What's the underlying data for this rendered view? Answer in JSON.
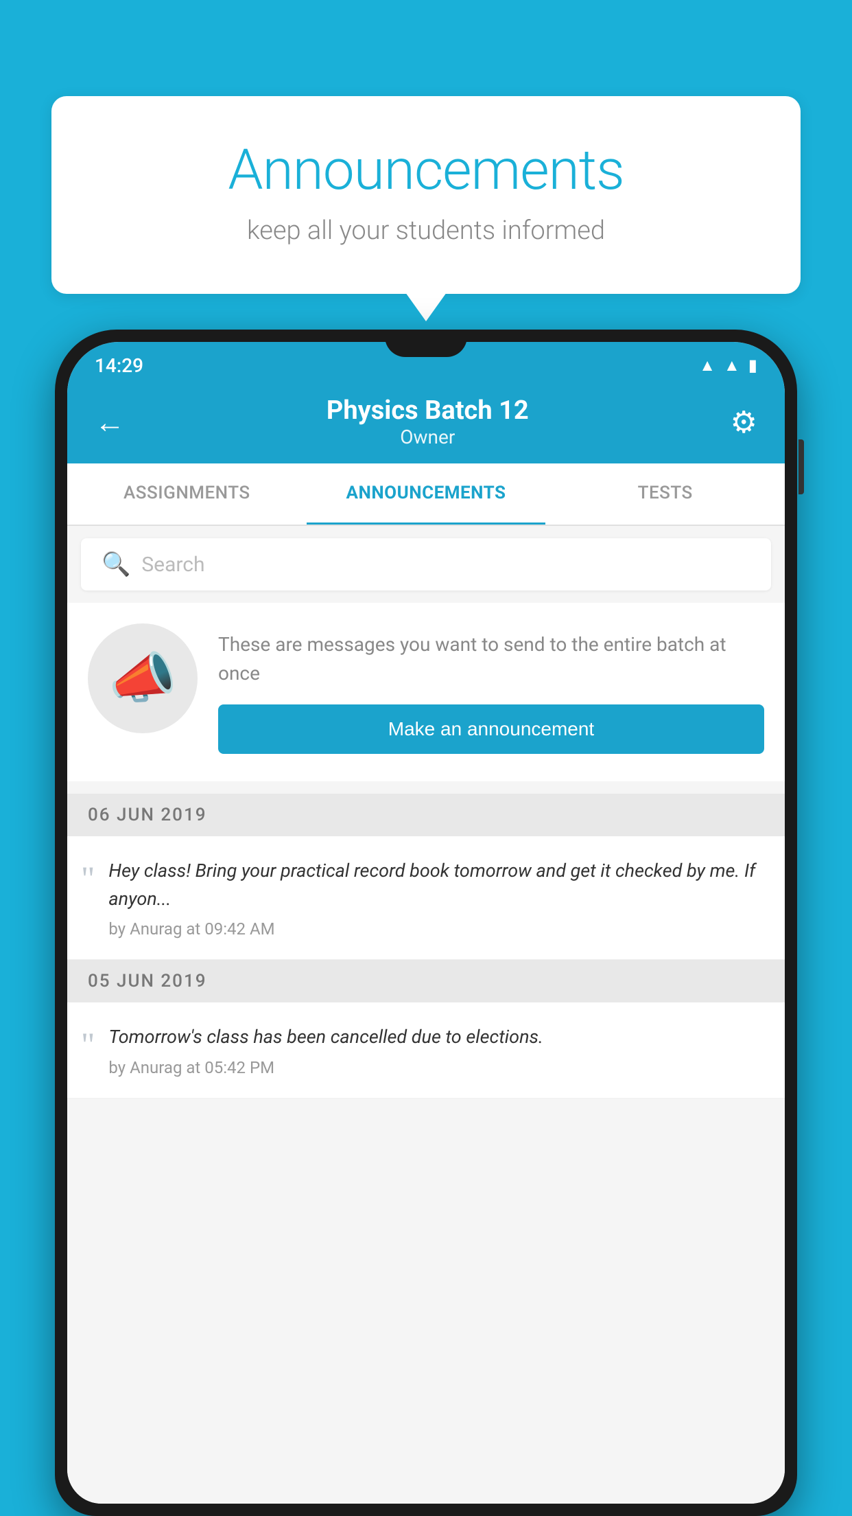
{
  "background_color": "#1ab0d8",
  "speech_bubble": {
    "title": "Announcements",
    "subtitle": "keep all your students informed"
  },
  "phone": {
    "status_bar": {
      "time": "14:29",
      "wifi_icon": "▲",
      "signal_icon": "▲",
      "battery_icon": "▮"
    },
    "header": {
      "back_label": "←",
      "title": "Physics Batch 12",
      "subtitle": "Owner",
      "gear_label": "⚙"
    },
    "tabs": [
      {
        "label": "ASSIGNMENTS",
        "active": false
      },
      {
        "label": "ANNOUNCEMENTS",
        "active": true
      },
      {
        "label": "TESTS",
        "active": false
      }
    ],
    "search": {
      "placeholder": "Search"
    },
    "promo": {
      "description": "These are messages you want to send to the entire batch at once",
      "button_label": "Make an announcement"
    },
    "announcement_groups": [
      {
        "date": "06  JUN  2019",
        "items": [
          {
            "text": "Hey class! Bring your practical record book tomorrow and get it checked by me. If anyon...",
            "meta": "by Anurag at 09:42 AM"
          }
        ]
      },
      {
        "date": "05  JUN  2019",
        "items": [
          {
            "text": "Tomorrow's class has been cancelled due to elections.",
            "meta": "by Anurag at 05:42 PM"
          }
        ]
      }
    ]
  }
}
